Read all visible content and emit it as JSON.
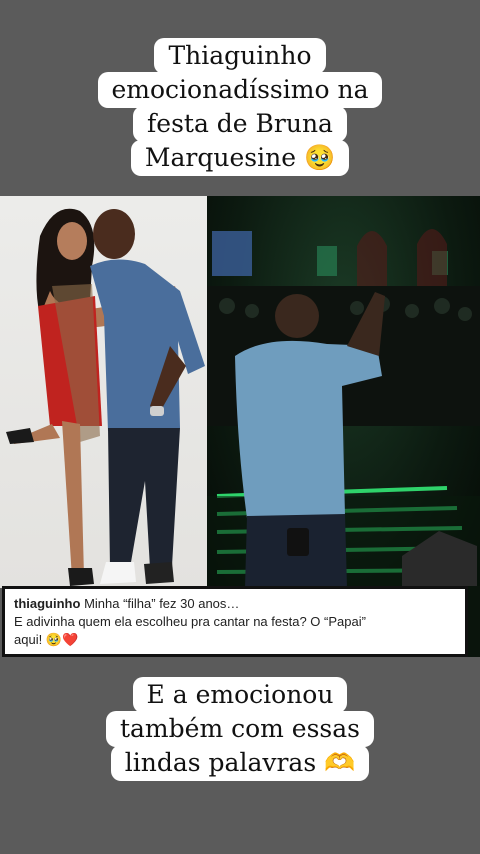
{
  "title_lines": [
    "Thiaguinho",
    "emocionadíssimo na",
    "festa de Bruna",
    "Marquesine 🥹"
  ],
  "caption": {
    "username": "thiaguinho",
    "line1": "Minha “filha” fez 30 anos…",
    "line2": "E adivinha quem ela escolheu pra cantar na festa? O “Papai”",
    "line3": "aqui! 🥹❤️"
  },
  "bottom_lines": [
    "E a emocionou",
    "também com essas",
    "lindas palavras 🫶"
  ],
  "colors": {
    "background": "#5b5b5b",
    "text_box": "#ffffff",
    "stage_green": "#2fd36b"
  }
}
